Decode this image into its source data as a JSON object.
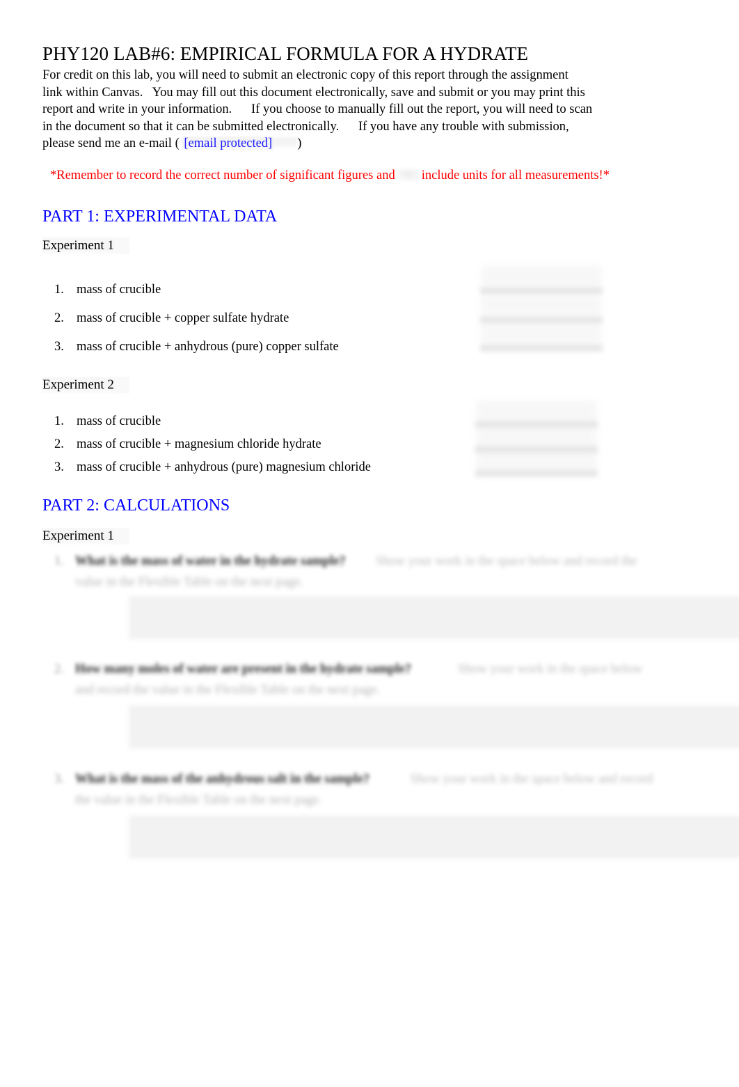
{
  "document": {
    "title": "PHY120 LAB#6: EMPIRICAL FORMULA FOR A HYDRATE",
    "intro": {
      "line1": "For credit on this lab, you will need to submit an electronic copy of this report through the assignment",
      "line2": "link within Canvas.   You may fill out this document electronically, save and submit or you may print this",
      "line3": "report and write in your information.      If you choose to manually fill out the report, you will need to scan",
      "line4": "in the document so that it can be submitted electronically.      If you have any trouble with submission,",
      "line5_before": "please send me an e-mail ( ",
      "email": "[email protected]",
      "line5_after": ")"
    },
    "reminder": {
      "before_gap": "*Remember to record the correct number of significant figures and",
      "after_gap": "include units for all measurements!*",
      "color": "#ff0000"
    }
  },
  "part1": {
    "heading": "PART 1: EXPERIMENTAL DATA",
    "heading_color": "#0000ff",
    "experiment1": {
      "label": "Experiment 1",
      "items": [
        {
          "num": "1.",
          "text": "mass of crucible"
        },
        {
          "num": "2.",
          "text": "mass of crucible + copper sulfate hydrate"
        },
        {
          "num": "3.",
          "text": "mass of crucible + anhydrous (pure) copper sulfate"
        }
      ],
      "blanks": [
        "",
        "",
        ""
      ]
    },
    "experiment2": {
      "label": "Experiment 2",
      "items": [
        {
          "num": "1.",
          "text": "mass of crucible"
        },
        {
          "num": "2.",
          "text": "mass of crucible + magnesium chloride hydrate"
        },
        {
          "num": "3.",
          "text": "mass of crucible + anhydrous (pure) magnesium chloride"
        }
      ],
      "blanks": [
        "",
        "",
        ""
      ]
    }
  },
  "part2": {
    "heading": "PART 2: CALCULATIONS",
    "heading_color": "#0000ff",
    "experiment1_label": "Experiment 1",
    "questions": [
      {
        "num": "1.",
        "prompt": "What is the mass of water in the hydrate sample?",
        "hint": "Show your work in the space below and record the",
        "hint2": "value in the Flexible Table on the next page.",
        "answer": ""
      },
      {
        "num": "2.",
        "prompt": "How many moles of water are present in the hydrate sample?",
        "hint": "Show your work in the space below",
        "hint2": "and record the value in the Flexible Table on the next page.",
        "answer": ""
      },
      {
        "num": "3.",
        "prompt": "What is the mass of the anhydrous salt in the sample?",
        "hint": "Show your work in the space below and record",
        "hint2": "the value in the Flexible Table on the next page.",
        "answer": ""
      }
    ]
  }
}
